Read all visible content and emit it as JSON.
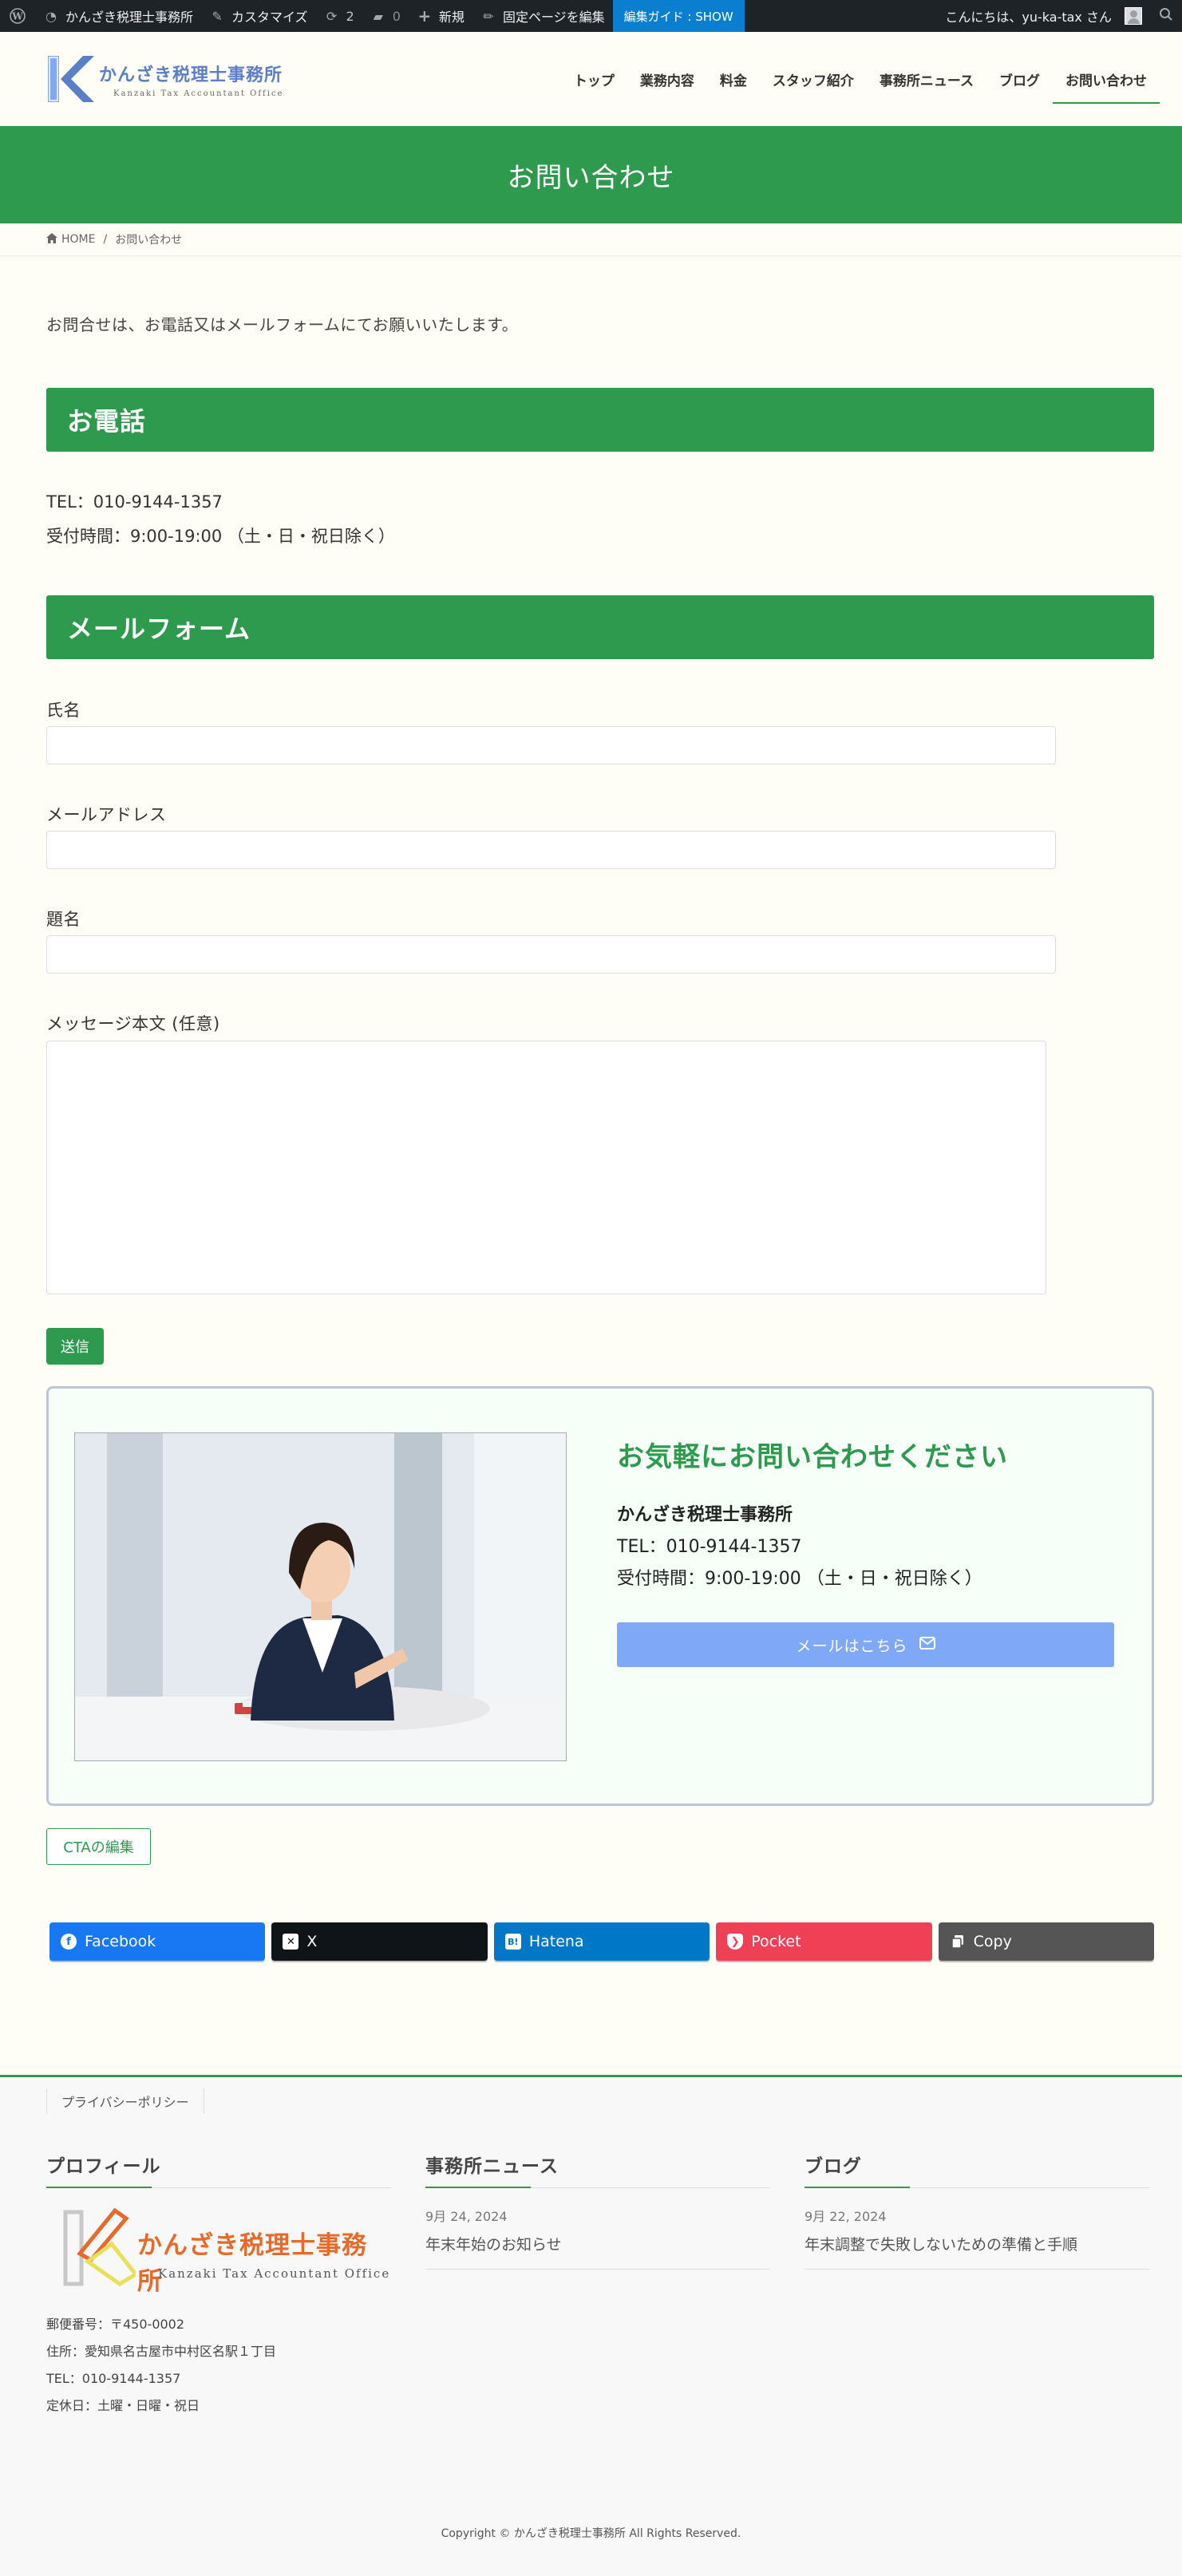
{
  "adminbar": {
    "site_name": "かんざき税理士事務所",
    "customize": "カスタマイズ",
    "updates_count": "2",
    "comments_count": "0",
    "new_label": "新規",
    "edit_page": "固定ページを編集",
    "guide": "編集ガイド : SHOW",
    "greeting": "こんにちは、yu-ka-tax さん"
  },
  "header": {
    "logo_text": "かんざき税理士事務所",
    "logo_sub": "Kanzaki Tax Accountant Office",
    "nav": [
      "トップ",
      "業務内容",
      "料金",
      "スタッフ紹介",
      "事務所ニュース",
      "ブログ",
      "お問い合わせ"
    ]
  },
  "page_title": "お問い合わせ",
  "breadcrumb": {
    "home": "HOME",
    "current": "お問い合わせ"
  },
  "content": {
    "lead": "お問合せは、お電話又はメールフォームにてお願いいたします。",
    "phone_heading": "お電話",
    "tel": "TEL：010-9144-1357",
    "hours": "受付時間：9:00-19:00 （土・日・祝日除く）",
    "form_heading": "メールフォーム",
    "form": {
      "name_label": "氏名",
      "email_label": "メールアドレス",
      "subject_label": "題名",
      "message_label": "メッセージ本文 (任意)",
      "submit": "送信"
    }
  },
  "cta": {
    "title": "お気軽にお問い合わせください",
    "office": "かんざき税理士事務所",
    "tel": "TEL：010-9144-1357",
    "hours": "受付時間：9:00-19:00 （土・日・祝日除く）",
    "button": "メールはこちら",
    "edit": "CTAの編集"
  },
  "share": [
    {
      "label": "Facebook",
      "color": "#1877f2",
      "icon": "facebook-icon"
    },
    {
      "label": "X",
      "color": "#0f1419",
      "icon": "x-icon"
    },
    {
      "label": "Hatena",
      "color": "#0077c7",
      "icon": "hatena-icon"
    },
    {
      "label": "Pocket",
      "color": "#ef4056",
      "icon": "pocket-icon"
    },
    {
      "label": "Copy",
      "color": "#555555",
      "icon": "copy-icon"
    }
  ],
  "footer": {
    "privacy": "プライバシーポリシー",
    "profile_title": "プロフィール",
    "profile_logo": "かんざき税理士事務所",
    "profile_logo_sub": "Kanzaki Tax Accountant Office",
    "postal": "郵便番号：〒450-0002",
    "address": "住所：愛知県名古屋市中村区名駅１丁目",
    "tel": "TEL：010-9144-1357",
    "holiday": "定休日：土曜・日曜・祝日",
    "news_title": "事務所ニュース",
    "news_date": "9月 24, 2024",
    "news_post": "年末年始のお知らせ",
    "blog_title": "ブログ",
    "blog_date": "9月 22, 2024",
    "blog_post": "年末調整で失敗しないための準備と手順",
    "copyright": "Copyright © かんざき税理士事務所 All Rights Reserved."
  },
  "colors": {
    "accent": "#2e9a4e",
    "cta_button": "#7fa8f7",
    "adminbar": "#1d2327"
  }
}
